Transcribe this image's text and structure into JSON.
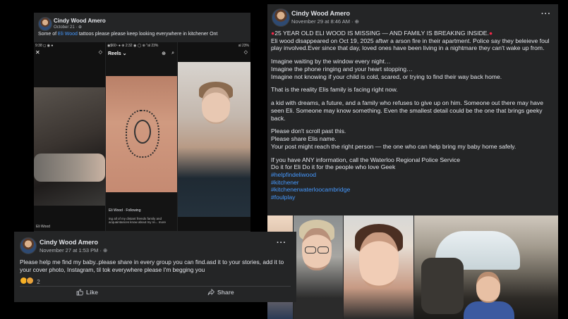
{
  "post_a": {
    "author": "Cindy Wood Amero",
    "date": "October 21",
    "caption_pre": "Some of ",
    "caption_link": "Eli Wood",
    "caption_post": "  tattoos please please keep looking everywhere in kitchener Ont",
    "reels": [
      {
        "status": "9:38 ◻ ◉ ●",
        "tag": "Eli Wood"
      },
      {
        "status": "◉$60▫ ● ⊕ 2:32 ◉ ◯ ⊕ \"al 23%",
        "header": "Reels ⌄",
        "user": "Eli Wood",
        "follow": "Following",
        "sub": "ing all of my distant friends family and\nacquaintances know about my re... more"
      },
      {
        "status": "al 23%",
        "tag": ""
      }
    ]
  },
  "post_b": {
    "author": "Cindy Wood Amero",
    "date": "November 29 at 8:46 AM · ",
    "headline": "25 YEAR OLD ELI WOOD  IS MISSING — AND FAMILY IS BREAKING INSIDE.",
    "p1": "Eli wood  disappeared on Oct 19, 2025 aftwr a arson fire in their apartment. Police say they beleieve foul play involved.Ever since that day, loved ones have been living in a nightmare they can't wake up from.",
    "p2a": "Imagine waiting by the window every night…",
    "p2b": "Imagine the phone ringing and your heart stopping…",
    "p2c": "Imagine not knowing if your child is cold, scared, or trying to find their way back home.",
    "p3": "That is the reality Elis family is facing right now.",
    "p4": " a kid with dreams, a future, and a family who refuses to give up on him. Someone out there may have seen Eli. Someone may know something. Even the smallest detail could be the one that brings geeky back.",
    "p5a": "Please don't scroll past this.",
    "p5b": "Please share Elis name.",
    "p5c": "Your post might reach the right person — the one who can help bring my baby home safely.",
    "p6a": "If you have ANY information, call the Waterloo Regional Police Service",
    "p6b": "Do it for Eli Do it for the people who  love Geek",
    "hashtags": [
      "#helpfindeliwood",
      "#kitchener",
      "#kitchenerwaterloocambridge",
      "#foulplay"
    ]
  },
  "post_c": {
    "author": "Cindy Wood Amero",
    "date": "November 27 at 1:53 PM · ",
    "text": "Please help me find my baby..please share in every group you can find.asd it to your stories, add it to your cover photo, Instagram,  til tok everywhere please  I'm begging you",
    "reaction_count": "2",
    "like_label": "Like",
    "share_label": "Share"
  },
  "colors": {
    "card_bg": "#242526",
    "link": "#4599ff",
    "alert": "#f02849",
    "page_bg": "#000000"
  },
  "icons": [
    "globe-icon",
    "more-icon",
    "like-icon",
    "share-icon",
    "siren-icon",
    "bookmark-icon",
    "close-icon",
    "search-icon"
  ]
}
